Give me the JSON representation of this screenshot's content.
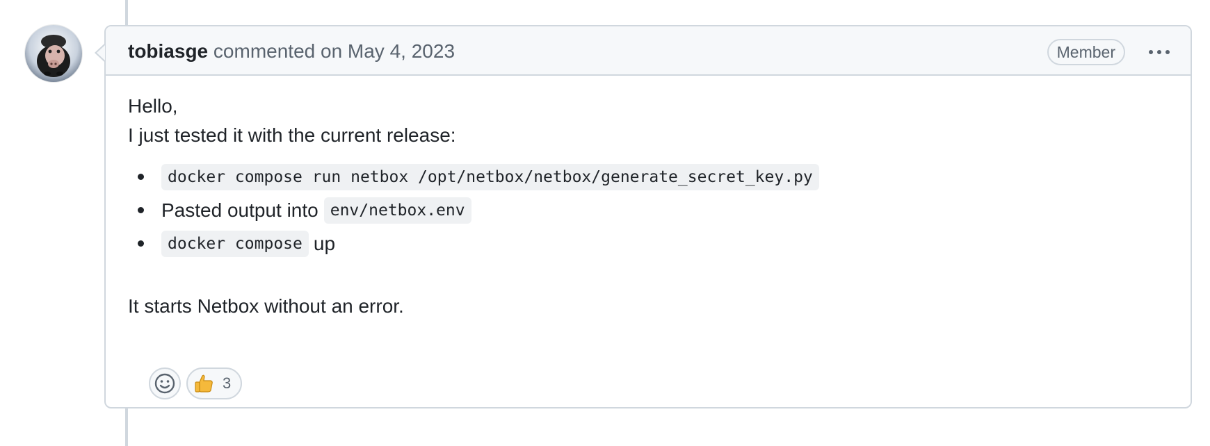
{
  "comment": {
    "author": "tobiasge",
    "meta_text": "commented on May 4, 2023",
    "role_badge": "Member",
    "body": {
      "greeting": "Hello,",
      "intro": "I just tested it with the current release:",
      "steps": [
        {
          "code": "docker compose run netbox /opt/netbox/netbox/generate_secret_key.py"
        },
        {
          "text": "Pasted output into",
          "code": "env/netbox.env"
        },
        {
          "code": "docker compose",
          "text": "up"
        }
      ],
      "closing": "It starts Netbox without an error."
    },
    "reactions": [
      {
        "emoji": "thumbs-up-icon",
        "count": "3"
      }
    ]
  },
  "icons": {
    "add_reaction": "smiley-icon",
    "options": "kebab-horizontal-icon"
  },
  "colors": {
    "border": "#d0d7de",
    "header_bg": "#f6f8fa",
    "text": "#1f2328",
    "muted": "#59636e",
    "code_bg": "#eff1f3"
  }
}
